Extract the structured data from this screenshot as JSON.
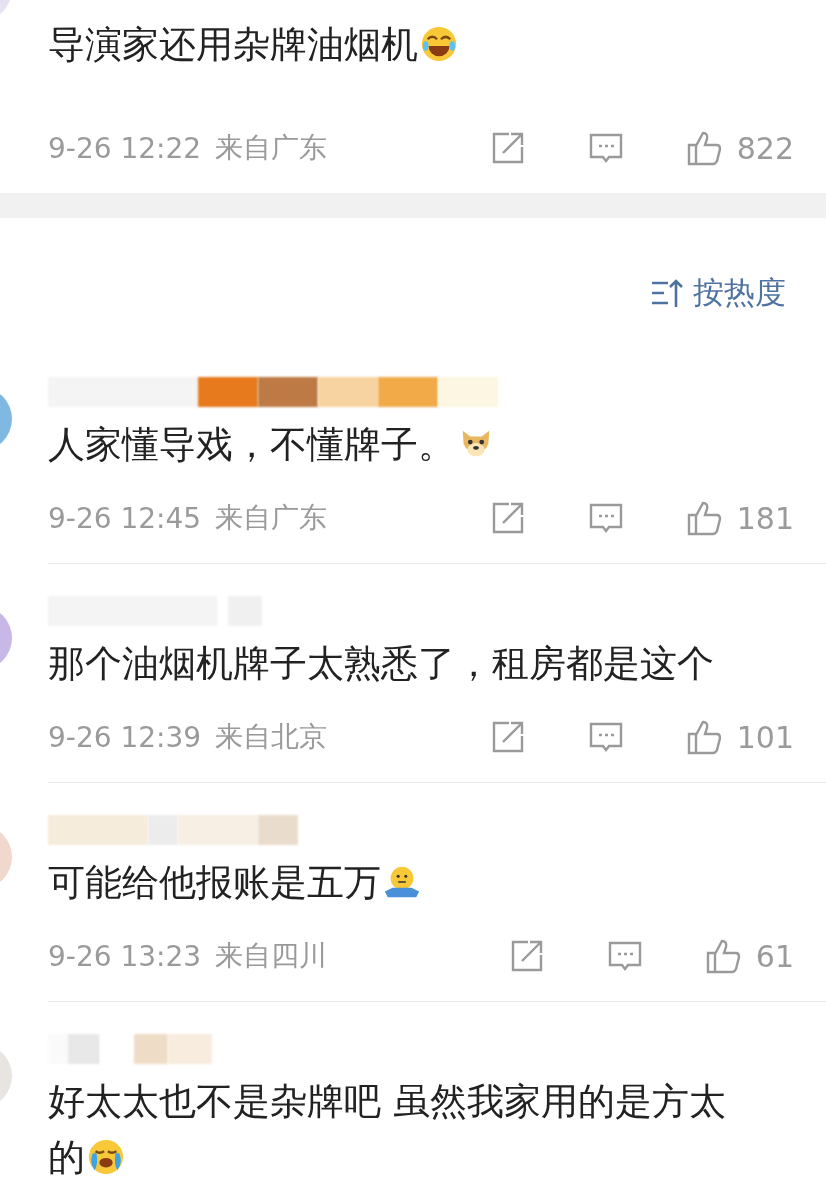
{
  "top_comment": {
    "text": "导演家还用杂牌油烟机",
    "emoji": {
      "kind": "laugh"
    },
    "time": "9-26 12:22",
    "location": "来自广东",
    "likes": "822"
  },
  "sort": {
    "label": "按热度"
  },
  "comments": [
    {
      "text": "人家懂导戏，不懂牌子。",
      "emoji": {
        "kind": "dog"
      },
      "time": "9-26 12:45",
      "location": "来自广东",
      "likes": "181"
    },
    {
      "text": "那个油烟机牌子太熟悉了，租房都是这个",
      "time": "9-26 12:39",
      "location": "来自北京",
      "likes": "101"
    },
    {
      "text": "可能给他报账是五万",
      "emoji": {
        "kind": "shrug"
      },
      "time": "9-26 13:23",
      "location": "来自四川",
      "likes": "61"
    },
    {
      "text": "好太太也不是杂牌吧 虽然我家用的是方太的",
      "emoji": {
        "kind": "cry"
      }
    }
  ]
}
